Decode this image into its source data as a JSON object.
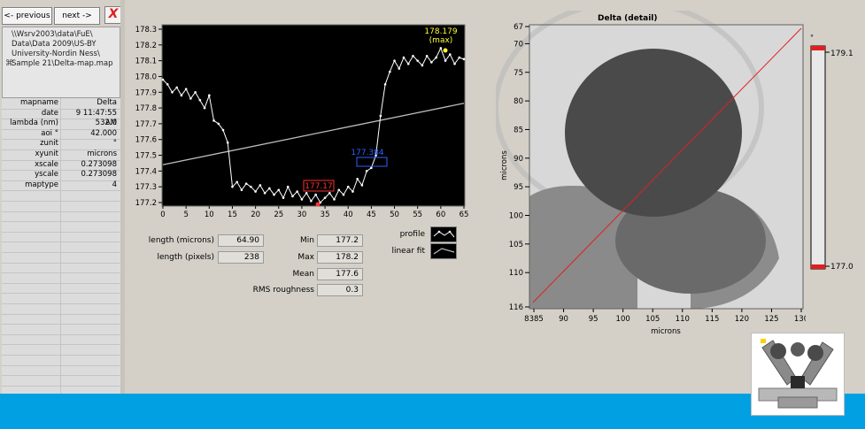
{
  "nav": {
    "previous_label": "<- previous",
    "next_label": "next ->",
    "close_label": "X"
  },
  "file_path": "\\\\Wsrv2003\\data\\FuE\\\nData\\Data 2009\\US-BY\nUniversity-Nordin Ness\\\nSample 21\\Delta-map.map",
  "properties": [
    {
      "key": "mapname",
      "value": "Delta"
    },
    {
      "key": "date",
      "value": "9 11:47:55 AM"
    },
    {
      "key": "lambda (nm)",
      "value": "532.0"
    },
    {
      "key": "aoi °",
      "value": "42.000"
    },
    {
      "key": "zunit",
      "value": "°"
    },
    {
      "key": "xyunit",
      "value": "microns"
    },
    {
      "key": "xscale",
      "value": "0.273098"
    },
    {
      "key": "yscale",
      "value": "0.273098"
    },
    {
      "key": "maptype",
      "value": "4"
    }
  ],
  "profile_chart": {
    "y_ticks": [
      "178.3",
      "178.2",
      "178.1",
      "178.0",
      "177.9",
      "177.8",
      "177.7",
      "177.6",
      "177.5",
      "177.4",
      "177.3",
      "177.2"
    ],
    "x_ticks": [
      "0",
      "5",
      "10",
      "15",
      "20",
      "25",
      "30",
      "35",
      "40",
      "45",
      "50",
      "55",
      "60",
      "65"
    ],
    "max_label": "178.179",
    "max_tag": "(max)",
    "cursor_label": "177.384",
    "min_label": "177.17"
  },
  "stats": {
    "length_microns_label": "length (microns)",
    "length_microns": "64.90",
    "length_pixels_label": "length (pixels)",
    "length_pixels": "238",
    "min_label": "Min",
    "min": "177.2",
    "max_label": "Max",
    "max": "178.2",
    "mean_label": "Mean",
    "mean": "177.6",
    "rms_label": "RMS roughness",
    "rms": "0.3"
  },
  "legend": {
    "profile": "profile",
    "linear_fit": "linear fit"
  },
  "map": {
    "title": "Delta (detail)",
    "y_ticks": [
      "67",
      "70",
      "75",
      "80",
      "85",
      "90",
      "95",
      "100",
      "105",
      "110",
      "116"
    ],
    "x_ticks": [
      "8385",
      "90",
      "95",
      "100",
      "105",
      "110",
      "115",
      "120",
      "125",
      "130"
    ],
    "xlabel": "microns",
    "ylabel": "microns"
  },
  "colorbar": {
    "unit": "°",
    "max": "179.1",
    "min": "177.0"
  },
  "colors": {
    "background": "#d4d0c8",
    "bottom_bar": "#00a0e3",
    "profile_line": "#ffffff",
    "fit_line": "#bdbdbd",
    "max_marker": "#ffff30",
    "cursor": "#3060ff",
    "min_marker": "#ff3030",
    "section_line": "#e02020"
  },
  "chart_data": {
    "type": "line",
    "title": "",
    "xlabel": "",
    "ylabel": "",
    "xlim": [
      0,
      65
    ],
    "ylim": [
      177.2,
      178.3
    ],
    "series": [
      {
        "name": "profile",
        "x": [
          0,
          1,
          2,
          3,
          4,
          5,
          6,
          7,
          8,
          9,
          10,
          11,
          12,
          13,
          14,
          15,
          16,
          17,
          18,
          19,
          20,
          21,
          22,
          23,
          24,
          25,
          26,
          27,
          28,
          29,
          30,
          31,
          32,
          33,
          34,
          35,
          36,
          37,
          38,
          39,
          40,
          41,
          42,
          43,
          44,
          45,
          46,
          47,
          48,
          49,
          50,
          51,
          52,
          53,
          54,
          55,
          56,
          57,
          58,
          59,
          60,
          61,
          62,
          63,
          64,
          65
        ],
        "y": [
          177.98,
          177.95,
          177.9,
          177.93,
          177.88,
          177.92,
          177.86,
          177.9,
          177.85,
          177.8,
          177.88,
          177.72,
          177.7,
          177.66,
          177.58,
          177.3,
          177.33,
          177.28,
          177.32,
          177.3,
          177.27,
          177.31,
          177.26,
          177.29,
          177.25,
          177.28,
          177.23,
          177.3,
          177.24,
          177.27,
          177.22,
          177.26,
          177.21,
          177.25,
          177.2,
          177.23,
          177.26,
          177.22,
          177.28,
          177.25,
          177.3,
          177.27,
          177.35,
          177.31,
          177.4,
          177.42,
          177.5,
          177.75,
          177.95,
          178.03,
          178.1,
          178.05,
          178.12,
          178.08,
          178.13,
          178.1,
          178.07,
          178.13,
          178.09,
          178.12,
          178.18,
          178.1,
          178.14,
          178.08,
          178.12,
          178.11
        ]
      },
      {
        "name": "linear fit",
        "x": [
          0,
          65
        ],
        "y": [
          177.44,
          177.83
        ]
      }
    ]
  }
}
